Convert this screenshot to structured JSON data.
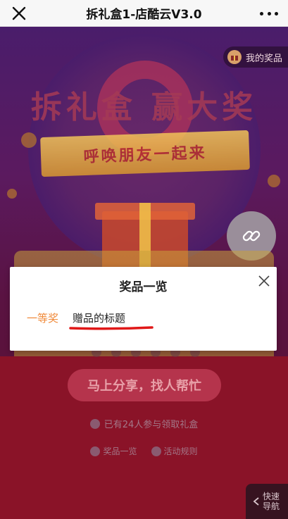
{
  "nav": {
    "title": "拆礼盒1-店酷云V3.0"
  },
  "background": {
    "my_prizes_label": "我的奖品",
    "hero_title": "拆礼盒 赢大奖",
    "ribbon_text": "呼唤朋友一起来",
    "share_button_label": "马上分享，找人帮忙",
    "claimed_text": "已有24人参与领取礼盒",
    "footer_links": [
      "奖品一览",
      "活动规则"
    ],
    "quick_nav_label": "快速导航"
  },
  "modal": {
    "title": "奖品一览",
    "prizes": [
      {
        "level": "一等奖",
        "name": "赠品的标题"
      }
    ]
  },
  "colors": {
    "accent_orange": "#f08a3a",
    "underline_red": "#e01818",
    "nav_bg": "#f7f7f7"
  }
}
